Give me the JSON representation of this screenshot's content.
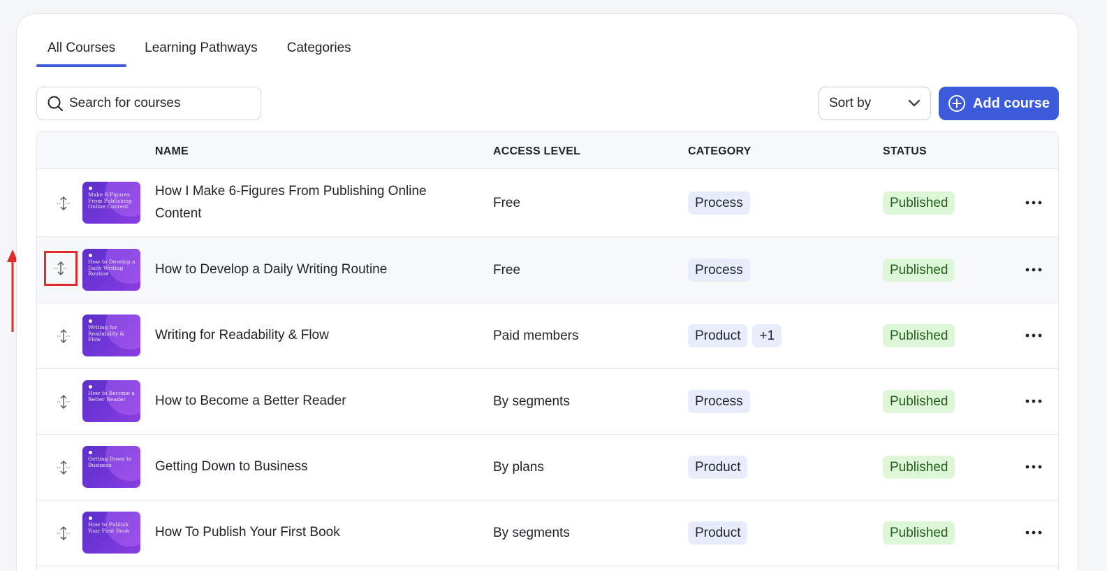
{
  "tabs": [
    {
      "label": "All Courses",
      "active": true
    },
    {
      "label": "Learning Pathways",
      "active": false
    },
    {
      "label": "Categories",
      "active": false
    }
  ],
  "search": {
    "placeholder": "Search for courses"
  },
  "sort": {
    "label": "Sort by"
  },
  "add_button": {
    "label": "Add course"
  },
  "table": {
    "columns": {
      "name": "NAME",
      "access": "ACCESS LEVEL",
      "category": "CATEGORY",
      "status": "STATUS"
    },
    "rows": [
      {
        "thumb": "Make 6-Figures From Publishing Online Content",
        "name": "How I Make 6-Figures From Publishing Online Content",
        "access": "Free",
        "categories": [
          "Process"
        ],
        "status": "Published"
      },
      {
        "thumb": "How to Develop a Daily Writing Routine",
        "name": "How to Develop a Daily Writing Routine",
        "access": "Free",
        "categories": [
          "Process"
        ],
        "status": "Published"
      },
      {
        "thumb": "Writing for Readability & Flow",
        "name": "Writing for Readability & Flow",
        "access": "Paid members",
        "categories": [
          "Product",
          "+1"
        ],
        "status": "Published"
      },
      {
        "thumb": "How to Become a Better Reader",
        "name": "How to Become a Better Reader",
        "access": "By segments",
        "categories": [
          "Process"
        ],
        "status": "Published"
      },
      {
        "thumb": "Getting Down to Business",
        "name": "Getting Down to Business",
        "access": "By plans",
        "categories": [
          "Product"
        ],
        "status": "Published"
      },
      {
        "thumb": "How to Publish Your First Book",
        "name": "How To Publish Your First Book",
        "access": "By segments",
        "categories": [
          "Product"
        ],
        "status": "Published"
      }
    ]
  },
  "colors": {
    "accent": "#3b5bdb",
    "status_bg": "#dff7d9",
    "chip_bg": "#e9edfb",
    "annotation_red": "#e02b2b"
  },
  "icons": {
    "search": "search-icon",
    "sort": "chevron-down-icon",
    "add": "plus-circle-icon",
    "drag": "drag-handle-icon",
    "more": "more-horizontal-icon",
    "annotation": "up-down-arrow-icon"
  }
}
